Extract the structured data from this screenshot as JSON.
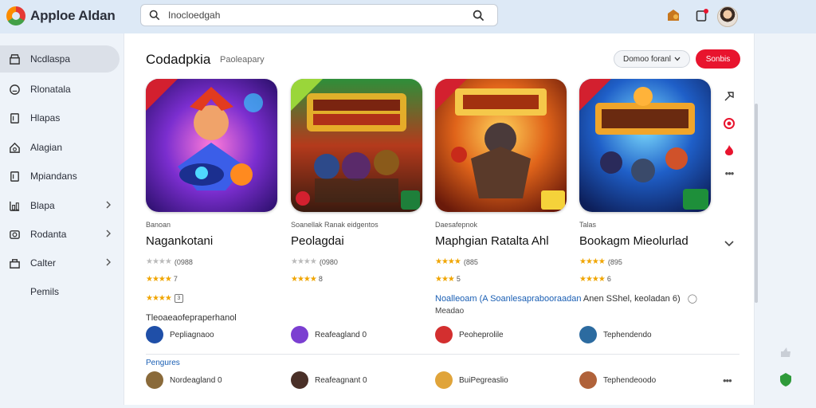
{
  "app": {
    "title": "Apploe Aldan"
  },
  "search": {
    "value": "Inocloedgah",
    "placeholder": ""
  },
  "sidebar": {
    "items": [
      {
        "label": "Ncdlaspa",
        "active": true,
        "icon": "store-icon",
        "chevron": false
      },
      {
        "label": "Rlonatala",
        "icon": "face-icon",
        "chevron": false
      },
      {
        "label": "Hlapas",
        "icon": "doc-icon",
        "chevron": false
      },
      {
        "label": "Alagian",
        "icon": "home-icon",
        "chevron": false
      },
      {
        "label": "Mpiandans",
        "icon": "doc-icon",
        "chevron": false
      },
      {
        "label": "Blapa",
        "icon": "chart-icon",
        "chevron": true
      },
      {
        "label": "Rodanta",
        "icon": "camera-icon",
        "chevron": true
      },
      {
        "label": "Calter",
        "icon": "bag-icon",
        "chevron": true
      },
      {
        "label": "Pemils",
        "icon": "",
        "chevron": false
      }
    ]
  },
  "main": {
    "heading": "Codadpkia",
    "subheading": "Paoleapary",
    "filter_label": "Domoo foranl",
    "cta_label": "Sonbis",
    "notice_link": "Noalleoam (A Soanlesaprabooraadan",
    "notice_rest": "Anen SShel, keoladan 6)",
    "notice2": "Meadao",
    "extra_count": "3",
    "desc1": "Tleoaeaofepraperhanol",
    "section_label": "Pengures"
  },
  "cards": [
    {
      "dev": "Banoan",
      "title": "Nagankotani",
      "meta": "(0988",
      "stars_a": "★★★★",
      "stars_b": "★★★★",
      "rating_b": "7",
      "icon": "hero-game-icon"
    },
    {
      "dev": "Soanellak Ranak eidgentos",
      "title": "Peolagdai",
      "meta": "(0980",
      "stars_a": "★★★★",
      "stars_b": "★★★★",
      "rating_b": "8",
      "icon": "wek-sorgsan-game-icon"
    },
    {
      "dev": "Daesafepnok",
      "title": "Maphgian Ratalta Ahl",
      "meta": "(885",
      "stars_a": "★★★★",
      "stars_b": "★★★",
      "rating_b": "5",
      "icon": "sunekiah-game-icon"
    },
    {
      "dev": "Talas",
      "title": "Bookagm Mieolurlad",
      "meta": "(895",
      "stars_a": "★★★★",
      "stars_b": "★★★★",
      "rating_b": "6",
      "icon": "nianarea-game-icon"
    }
  ],
  "publishers_row1": [
    {
      "name": "Pepliagnaoo",
      "color": "#1f4fa8"
    },
    {
      "name": "Reafeagland 0",
      "color": "#7b3fd1"
    },
    {
      "name": "Peoheprolile",
      "color": "#d32f2f"
    },
    {
      "name": "Tephendendo",
      "color": "#2c6ba0"
    }
  ],
  "publishers_row2": [
    {
      "name": "Nordeagland 0",
      "color": "#8a6a3a"
    },
    {
      "name": "Reafeagnant 0",
      "color": "#4a3028"
    },
    {
      "name": "BuiPegreaslio",
      "color": "#e0a43a"
    },
    {
      "name": "Tephendeoodo",
      "color": "#b0623a"
    }
  ],
  "colors": {
    "accent": "#e8142e",
    "link": "#1a5fb4",
    "star": "#f0a500"
  }
}
